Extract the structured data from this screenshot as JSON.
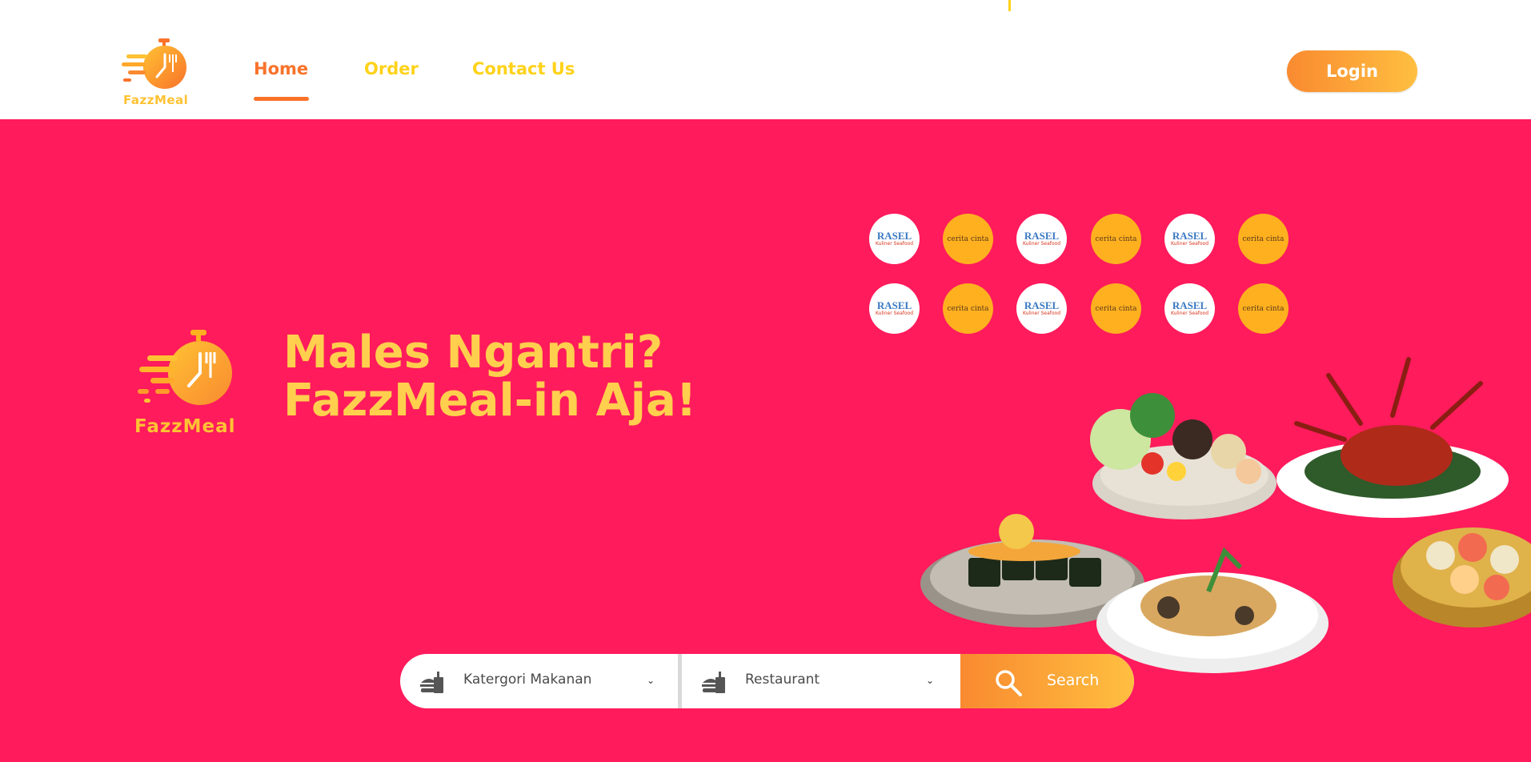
{
  "brand": {
    "name": "FazzMeal"
  },
  "nav": {
    "items": [
      {
        "label": "Home",
        "active": true
      },
      {
        "label": "Order",
        "active": false
      },
      {
        "label": "Contact Us",
        "active": false
      }
    ],
    "login_label": "Login"
  },
  "hero": {
    "headline_line1": "Males Ngantri?",
    "headline_line2": "FazzMeal-in Aja!",
    "partners": [
      {
        "name": "Rasel",
        "label_top": "RASEL",
        "label_bottom": "Kuliner Seafood"
      },
      {
        "name": "Cerita Cinta",
        "label": "cerita cinta"
      }
    ]
  },
  "search": {
    "category_label": "Katergori Makanan",
    "restaurant_label": "Restaurant",
    "button_label": "Search"
  },
  "colors": {
    "hero_bg": "#ff1b5c",
    "accent_orange": "#f9722a",
    "accent_yellow": "#ffd21a",
    "headline_yellow": "#ffcf4d",
    "button_gradient_start": "#f98a30",
    "button_gradient_end": "#ffbf40"
  },
  "icons": {
    "logo": "stopwatch-fork-logo-icon",
    "search": "search-icon",
    "food_field": "burger-drink-icon",
    "chevron": "chevron-down-icon"
  }
}
